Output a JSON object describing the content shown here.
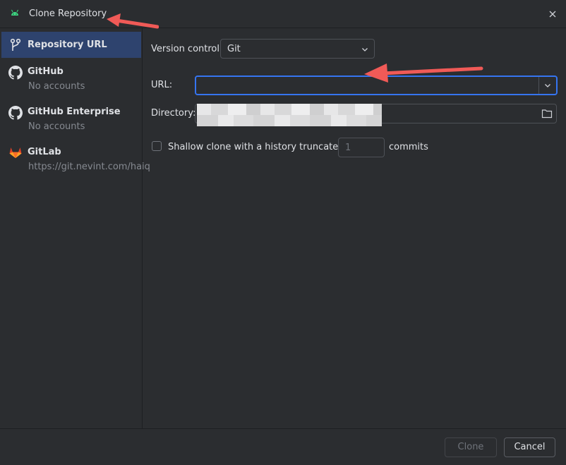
{
  "window": {
    "title": "Clone Repository",
    "icon": "android-icon",
    "close_icon": "close-icon"
  },
  "sidebar": {
    "items": [
      {
        "label": "Repository URL",
        "sub": "",
        "icon": "vcs-branch-icon",
        "selected": true
      },
      {
        "label": "GitHub",
        "sub": "No accounts",
        "icon": "github-icon",
        "selected": false
      },
      {
        "label": "GitHub Enterprise",
        "sub": "No accounts",
        "icon": "github-icon",
        "selected": false
      },
      {
        "label": "GitLab",
        "sub": "https://git.nevint.com/haiq",
        "icon": "gitlab-icon",
        "selected": false
      }
    ]
  },
  "form": {
    "version_control_label": "Version control:",
    "version_control_value": "Git",
    "url_label": "URL:",
    "url_value": "",
    "directory_label": "Directory:",
    "directory_value": "",
    "shallow_label": "Shallow clone with a history truncated to",
    "shallow_checked": false,
    "depth_value": "1",
    "commits_label": "commits"
  },
  "footer": {
    "clone_label": "Clone",
    "cancel_label": "Cancel"
  },
  "colors": {
    "background": "#2b2d30",
    "selection": "#2e436e",
    "focus": "#3574f0",
    "annotation_arrow": "#f05a57",
    "gitlab": "#e24329",
    "android": "#3ddc84"
  }
}
